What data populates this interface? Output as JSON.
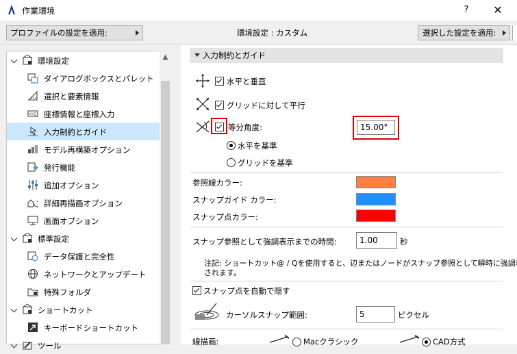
{
  "window": {
    "title": "作業環境",
    "help": "?",
    "close": "✕"
  },
  "toolbar": {
    "apply_profile": "プロファイルの設定を適用:",
    "env_label": "環境設定 : カスタム",
    "apply_selected": "選択した設定を適用:"
  },
  "tree": {
    "items": [
      {
        "label": "環境設定",
        "level": 0,
        "icon": "house-settings-icon"
      },
      {
        "label": "ダイアログボックスとパレット",
        "level": 1,
        "icon": "dialog-palette-icon"
      },
      {
        "label": "選択と要素情報",
        "level": 1,
        "icon": "selection-icon"
      },
      {
        "label": "座標情報と座標入力",
        "level": 1,
        "icon": "xyz-icon"
      },
      {
        "label": "入力制約とガイド",
        "level": 1,
        "icon": "cursor-guide-icon",
        "selected": true
      },
      {
        "label": "モデル再構築オプション",
        "level": 1,
        "icon": "rebuild-icon"
      },
      {
        "label": "発行機能",
        "level": 1,
        "icon": "publish-icon"
      },
      {
        "label": "追加オプション",
        "level": 1,
        "icon": "sliders-icon"
      },
      {
        "label": "詳細再描画オプション",
        "level": 1,
        "icon": "redraw-icon"
      },
      {
        "label": "画面オプション",
        "level": 1,
        "icon": "monitor-icon"
      },
      {
        "label": "標準設定",
        "level": 0,
        "icon": "standard-settings-icon"
      },
      {
        "label": "データ保護と完全性",
        "level": 1,
        "icon": "data-protect-icon"
      },
      {
        "label": "ネットワークとアップデート",
        "level": 1,
        "icon": "globe-icon"
      },
      {
        "label": "特殊フォルダ",
        "level": 1,
        "icon": "folder-icon"
      },
      {
        "label": "ショートカット",
        "level": 0,
        "icon": "shortcut-settings-icon"
      },
      {
        "label": "キーボードショートカット",
        "level": 1,
        "icon": "shortcut-arrow-icon"
      },
      {
        "label": "ツール",
        "level": 0,
        "icon": "tools-icon"
      }
    ]
  },
  "section": {
    "title": "入力制約とガイド"
  },
  "options": {
    "horizontal_vertical": "水平と垂直",
    "parallel_grid": "グリッドに対して平行",
    "division_angle": "等分角度:",
    "angle_value": "15.00°",
    "radio_horizontal": "水平を基準",
    "radio_grid": "グリッドを基準"
  },
  "colors": {
    "ref_line_label": "参照線カラー:",
    "snap_guide_label": "スナップガイド カラー:",
    "snap_point_label": "スナップ点カラー:",
    "ref_line": "#ff8040",
    "snap_guide": "#1e90ff",
    "snap_point": "#ff0000"
  },
  "timing": {
    "label": "スナップ参照として強調表示までの時間:",
    "value": "1.00",
    "unit": "秒",
    "note_line1": "注記: ショートカット@ / Qを使用すると、辺またはノードがスナップ参照として瞬時に強調表示",
    "note_line2": "されます。"
  },
  "snap": {
    "auto_hide": "スナップ点を自動で隠す",
    "cursor_range_label": "カーソルスナップ範囲:",
    "cursor_range_value": "5",
    "cursor_range_unit": "ピクセル"
  },
  "line_drawing": {
    "label": "線描画:",
    "mac_classic": "Macクラシック",
    "cad_style": "CAD方式"
  }
}
